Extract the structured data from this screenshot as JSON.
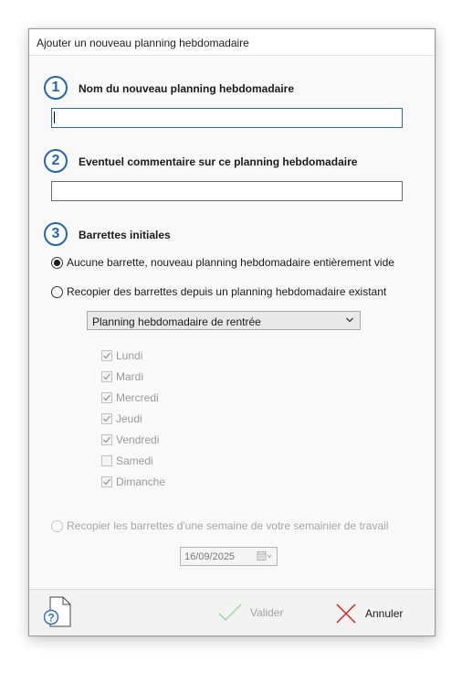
{
  "dialog": {
    "title": "Ajouter un nouveau planning hebdomadaire"
  },
  "steps": [
    {
      "number": "1",
      "label": "Nom du nouveau planning hebdomadaire"
    },
    {
      "number": "2",
      "label": "Eventuel commentaire sur ce planning hebdomadaire"
    },
    {
      "number": "3",
      "label": "Barrettes initiales"
    }
  ],
  "name_input": {
    "value": ""
  },
  "comment_input": {
    "value": ""
  },
  "options": {
    "empty": {
      "label": "Aucune barrette, nouveau planning hebdomadaire entièrement vide",
      "checked": true
    },
    "copy_existing": {
      "label": "Recopier des barrettes depuis un planning hebdomadaire existant",
      "checked": false
    },
    "copy_week": {
      "label": "Recopier les barrettes d'une semaine de votre semainier de travail",
      "checked": false,
      "disabled": true
    }
  },
  "planning_select": {
    "selected": "Planning hebdomadaire de rentrée"
  },
  "days": [
    {
      "label": "Lundi",
      "checked": true
    },
    {
      "label": "Mardi",
      "checked": true
    },
    {
      "label": "Mercredi",
      "checked": true
    },
    {
      "label": "Jeudi",
      "checked": true
    },
    {
      "label": "Vendredi",
      "checked": true
    },
    {
      "label": "Samedi",
      "checked": false
    },
    {
      "label": "Dimanche",
      "checked": true
    }
  ],
  "week_date": {
    "value": "16/09/2025"
  },
  "footer": {
    "validate_label": "Valider",
    "cancel_label": "Annuler"
  },
  "colors": {
    "accent": "#2466b3",
    "cancel_red": "#e02020",
    "validate_disabled": "#a9d6a9"
  },
  "icons": {
    "help": "help-document-icon",
    "validate": "check-icon",
    "cancel": "cross-icon",
    "select_arrow": "chevron-down-icon",
    "calendar": "calendar-icon"
  }
}
